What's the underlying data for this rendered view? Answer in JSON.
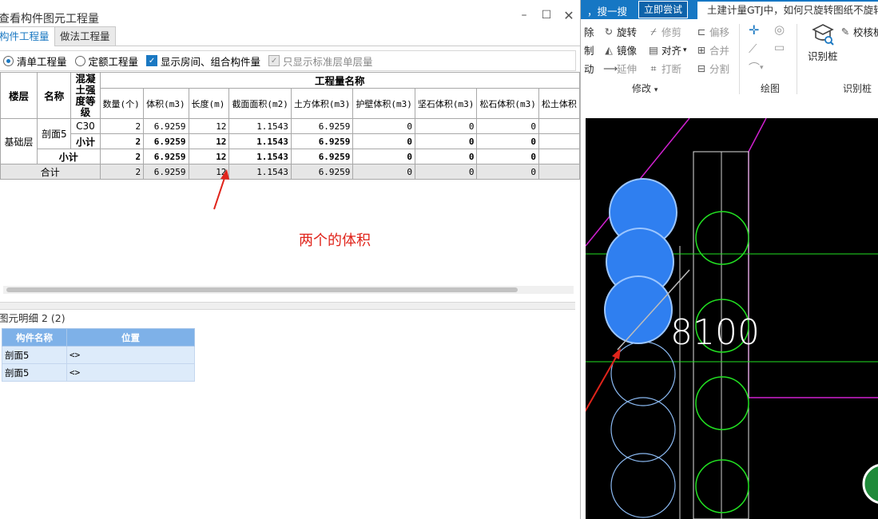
{
  "dialog": {
    "title": "查看构件图元工程量",
    "window_buttons": {
      "minimize": "–",
      "maximize": "☐",
      "close": "✕"
    },
    "tabs": [
      {
        "label": "构件工程量",
        "active": true
      },
      {
        "label": "做法工程量",
        "active": false
      }
    ],
    "options": {
      "radio_list": "清单工程量",
      "radio_quota": "定额工程量",
      "show_rooms": "显示房间、组合构件量",
      "std_floor_only": "只显示标准层单层量"
    },
    "table": {
      "headers": {
        "floor": "楼层",
        "name": "名称",
        "grade": "混凝土强度等级",
        "group": "工程量名称",
        "cols": [
          "数量(个)",
          "体积(m3)",
          "长度(m)",
          "截面面积(m2)",
          "土方体积(m3)",
          "护壁体积(m3)",
          "坚石体积(m3)",
          "松石体积(m3)",
          "松土体积"
        ]
      },
      "rows": [
        {
          "floor": "基础层",
          "name": "剖面5",
          "grade": "C30",
          "values": [
            "2",
            "6.9259",
            "12",
            "1.1543",
            "6.9259",
            "0",
            "0",
            "0",
            ""
          ]
        },
        {
          "label": "小计",
          "values": [
            "2",
            "6.9259",
            "12",
            "1.1543",
            "6.9259",
            "0",
            "0",
            "0",
            ""
          ]
        },
        {
          "label": "小计",
          "values": [
            "2",
            "6.9259",
            "12",
            "1.1543",
            "6.9259",
            "0",
            "0",
            "0",
            ""
          ]
        },
        {
          "label": "合计",
          "values": [
            "2",
            "6.9259",
            "12",
            "1.1543",
            "6.9259",
            "0",
            "0",
            "0",
            ""
          ]
        }
      ]
    },
    "annotation": "两个的体积",
    "detail": {
      "title": "图元明细  2 (2)",
      "headers": [
        "构件名称",
        "位置"
      ],
      "rows": [
        {
          "name": "剖面5",
          "pos": "<>"
        },
        {
          "name": "剖面5",
          "pos": "<>"
        }
      ]
    }
  },
  "topbar": {
    "search": "，搜一搜",
    "try_button": "立即尝试",
    "news": "土建计量GTJ中，如何只旋转图纸不旋转"
  },
  "ribbon": {
    "modify": {
      "items": [
        "除",
        "旋转",
        "修剪",
        "偏移",
        "制",
        "镜像",
        "对齐",
        "合并",
        "动",
        "延伸",
        "打断",
        "分割"
      ],
      "group_label": "修改"
    },
    "draw_group_label": "绘图",
    "identify_pile": {
      "button": "识别桩",
      "check": "校核桩",
      "group_label": "识别桩"
    }
  },
  "canvas": {
    "dimension_text": "8100"
  },
  "colors": {
    "accent": "#1677c4",
    "annotation": "#e0241b",
    "pile_blue": "#2f7ff0",
    "grid_green": "#22e022",
    "wall_magenta": "#d020d0"
  }
}
